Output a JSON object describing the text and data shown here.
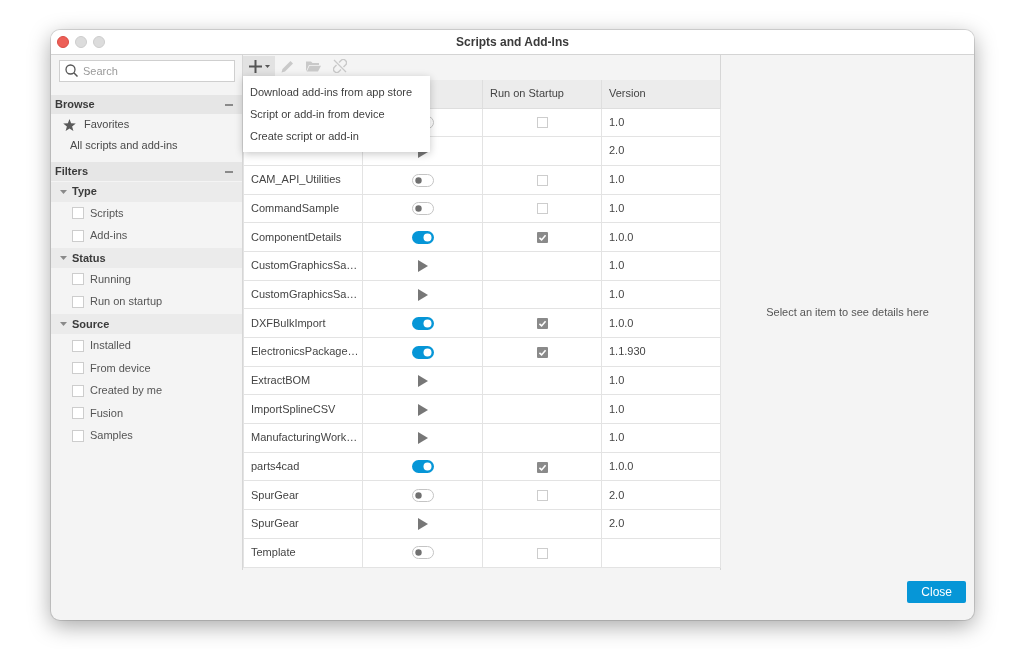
{
  "window": {
    "title": "Scripts and Add-Ins"
  },
  "sidebar": {
    "search": {
      "placeholder": "Search"
    },
    "browse": {
      "title": "Browse",
      "expanded": true,
      "items": [
        {
          "label": "Favorites",
          "kind": "favorites",
          "selected": false
        },
        {
          "label": "All scripts and add-ins",
          "kind": "all",
          "selected": false
        }
      ]
    },
    "filters": {
      "title": "Filters",
      "expanded": true,
      "groups": [
        {
          "title": "Type",
          "expanded": true,
          "items": [
            {
              "label": "Scripts",
              "checked": false
            },
            {
              "label": "Add-ins",
              "checked": false
            }
          ]
        },
        {
          "title": "Status",
          "expanded": true,
          "items": [
            {
              "label": "Running",
              "checked": false
            },
            {
              "label": "Run on startup",
              "checked": false
            }
          ]
        },
        {
          "title": "Source",
          "expanded": true,
          "items": [
            {
              "label": "Installed",
              "checked": false
            },
            {
              "label": "From device",
              "checked": false
            },
            {
              "label": "Created by me",
              "checked": false
            },
            {
              "label": "Fusion",
              "checked": false
            },
            {
              "label": "Samples",
              "checked": false
            }
          ]
        }
      ]
    }
  },
  "toolbar": [
    {
      "kind": "add",
      "disabled": false
    },
    {
      "kind": "edit",
      "disabled": true
    },
    {
      "kind": "folder",
      "disabled": true
    },
    {
      "kind": "unlink",
      "disabled": true
    }
  ],
  "add_menu": {
    "open": true,
    "items": [
      "Download add-ins from app store",
      "Script or add-in from device",
      "Create script or add-in"
    ]
  },
  "table": {
    "columns": {
      "column_3": "Run on Startup",
      "column_4": "Version"
    },
    "rows": [
      {
        "kind": "addin",
        "running": false,
        "run_on_startup": false,
        "version": "1.0"
      },
      {
        "kind": "script",
        "version": "2.0"
      },
      {
        "name": "CAM_API_Utilities",
        "kind": "addin",
        "running": false,
        "run_on_startup": false,
        "version": "1.0"
      },
      {
        "name": "CommandSample",
        "kind": "addin",
        "running": false,
        "run_on_startup": false,
        "version": "1.0"
      },
      {
        "name": "ComponentDetails",
        "kind": "addin",
        "running": true,
        "run_on_startup": true,
        "version": "1.0.0"
      },
      {
        "name": "CustomGraphicsSa…",
        "kind": "script",
        "version": "1.0"
      },
      {
        "name": "CustomGraphicsSa…",
        "kind": "script",
        "version": "1.0"
      },
      {
        "name": "DXFBulkImport",
        "kind": "addin",
        "running": true,
        "run_on_startup": true,
        "version": "1.0.0"
      },
      {
        "name": "ElectronicsPackage…",
        "kind": "addin",
        "running": true,
        "run_on_startup": true,
        "version": "1.1.930"
      },
      {
        "name": "ExtractBOM",
        "kind": "script",
        "version": "1.0"
      },
      {
        "name": "ImportSplineCSV",
        "kind": "script",
        "version": "1.0"
      },
      {
        "name": "ManufacturingWork…",
        "kind": "script",
        "version": "1.0"
      },
      {
        "name": "parts4cad",
        "kind": "addin",
        "running": true,
        "run_on_startup": true,
        "version": "1.0.0"
      },
      {
        "name": "SpurGear",
        "kind": "addin",
        "running": false,
        "run_on_startup": false,
        "version": "2.0"
      },
      {
        "name": "SpurGear",
        "kind": "script",
        "version": "2.0"
      },
      {
        "name": "Template",
        "kind": "addin",
        "running": false,
        "run_on_startup": false
      }
    ]
  },
  "details_pane": {
    "message": "Select an item to see details here"
  },
  "buttons": [
    {
      "label": "Close",
      "kind": "primary"
    }
  ]
}
